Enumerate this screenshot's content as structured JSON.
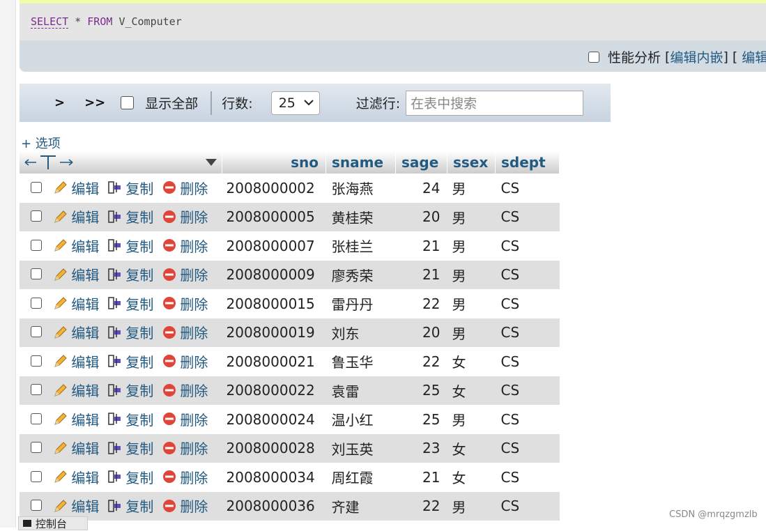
{
  "query": {
    "select": "SELECT",
    "star": "*",
    "from": "FROM",
    "view": "V_Computer"
  },
  "query_actions": {
    "profiling": "性能分析",
    "edit_inline": "编辑内嵌",
    "edit": "编辑"
  },
  "nav": {
    "next": ">",
    "last": ">>",
    "show_all": "显示全部",
    "rows_label": "行数:",
    "rows_value": "25",
    "filter_label": "过滤行:",
    "filter_placeholder": "在表中搜索"
  },
  "options_label": "+ 选项",
  "table": {
    "columns": [
      "sno",
      "sname",
      "sage",
      "ssex",
      "sdept"
    ],
    "row_actions": {
      "edit": "编辑",
      "copy": "复制",
      "delete": "删除"
    },
    "rows": [
      [
        "2008000002",
        "张海燕",
        "24",
        "男",
        "CS"
      ],
      [
        "2008000005",
        "黄桂荣",
        "20",
        "男",
        "CS"
      ],
      [
        "2008000007",
        "张桂兰",
        "21",
        "男",
        "CS"
      ],
      [
        "2008000009",
        "廖秀荣",
        "21",
        "男",
        "CS"
      ],
      [
        "2008000015",
        "雷丹丹",
        "22",
        "男",
        "CS"
      ],
      [
        "2008000019",
        "刘东",
        "20",
        "男",
        "CS"
      ],
      [
        "2008000021",
        "鲁玉华",
        "22",
        "女",
        "CS"
      ],
      [
        "2008000022",
        "袁雷",
        "25",
        "女",
        "CS"
      ],
      [
        "2008000024",
        "温小红",
        "25",
        "男",
        "CS"
      ],
      [
        "2008000028",
        "刘玉英",
        "23",
        "女",
        "CS"
      ],
      [
        "2008000034",
        "周红霞",
        "21",
        "女",
        "CS"
      ],
      [
        "2008000036",
        "齐建",
        "22",
        "男",
        "CS"
      ]
    ]
  },
  "console_label": "控制台",
  "watermark": "CSDN @mrqzgmzlb"
}
